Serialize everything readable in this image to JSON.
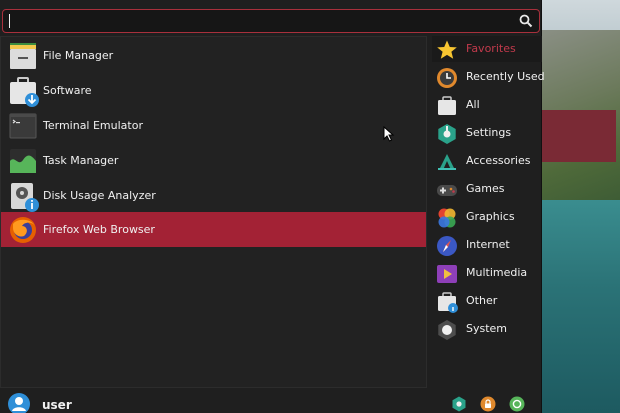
{
  "search": {
    "value": "",
    "placeholder": ""
  },
  "apps": [
    {
      "label": "File Manager",
      "icon": "file-manager-icon"
    },
    {
      "label": "Software",
      "icon": "software-icon"
    },
    {
      "label": "Terminal Emulator",
      "icon": "terminal-icon"
    },
    {
      "label": "Task Manager",
      "icon": "task-manager-icon"
    },
    {
      "label": "Disk Usage Analyzer",
      "icon": "disk-usage-icon"
    },
    {
      "label": "Firefox Web Browser",
      "icon": "firefox-icon",
      "selected": true
    }
  ],
  "categories": [
    {
      "label": "Favorites",
      "icon": "star-icon",
      "active": true
    },
    {
      "label": "Recently Used",
      "icon": "clock-icon"
    },
    {
      "label": "All",
      "icon": "all-apps-icon"
    },
    {
      "label": "Settings",
      "icon": "settings-icon"
    },
    {
      "label": "Accessories",
      "icon": "accessories-icon"
    },
    {
      "label": "Games",
      "icon": "gamepad-icon"
    },
    {
      "label": "Graphics",
      "icon": "graphics-icon"
    },
    {
      "label": "Internet",
      "icon": "internet-icon"
    },
    {
      "label": "Multimedia",
      "icon": "multimedia-icon"
    },
    {
      "label": "Other",
      "icon": "other-icon"
    },
    {
      "label": "System",
      "icon": "system-icon"
    }
  ],
  "footer": {
    "username": "user",
    "actions": [
      "settings-icon",
      "lock-icon",
      "logout-icon"
    ]
  },
  "colors": {
    "accent": "#a32235",
    "menu_bg": "#1f1f1f",
    "favorites_text": "#c23a4c"
  }
}
